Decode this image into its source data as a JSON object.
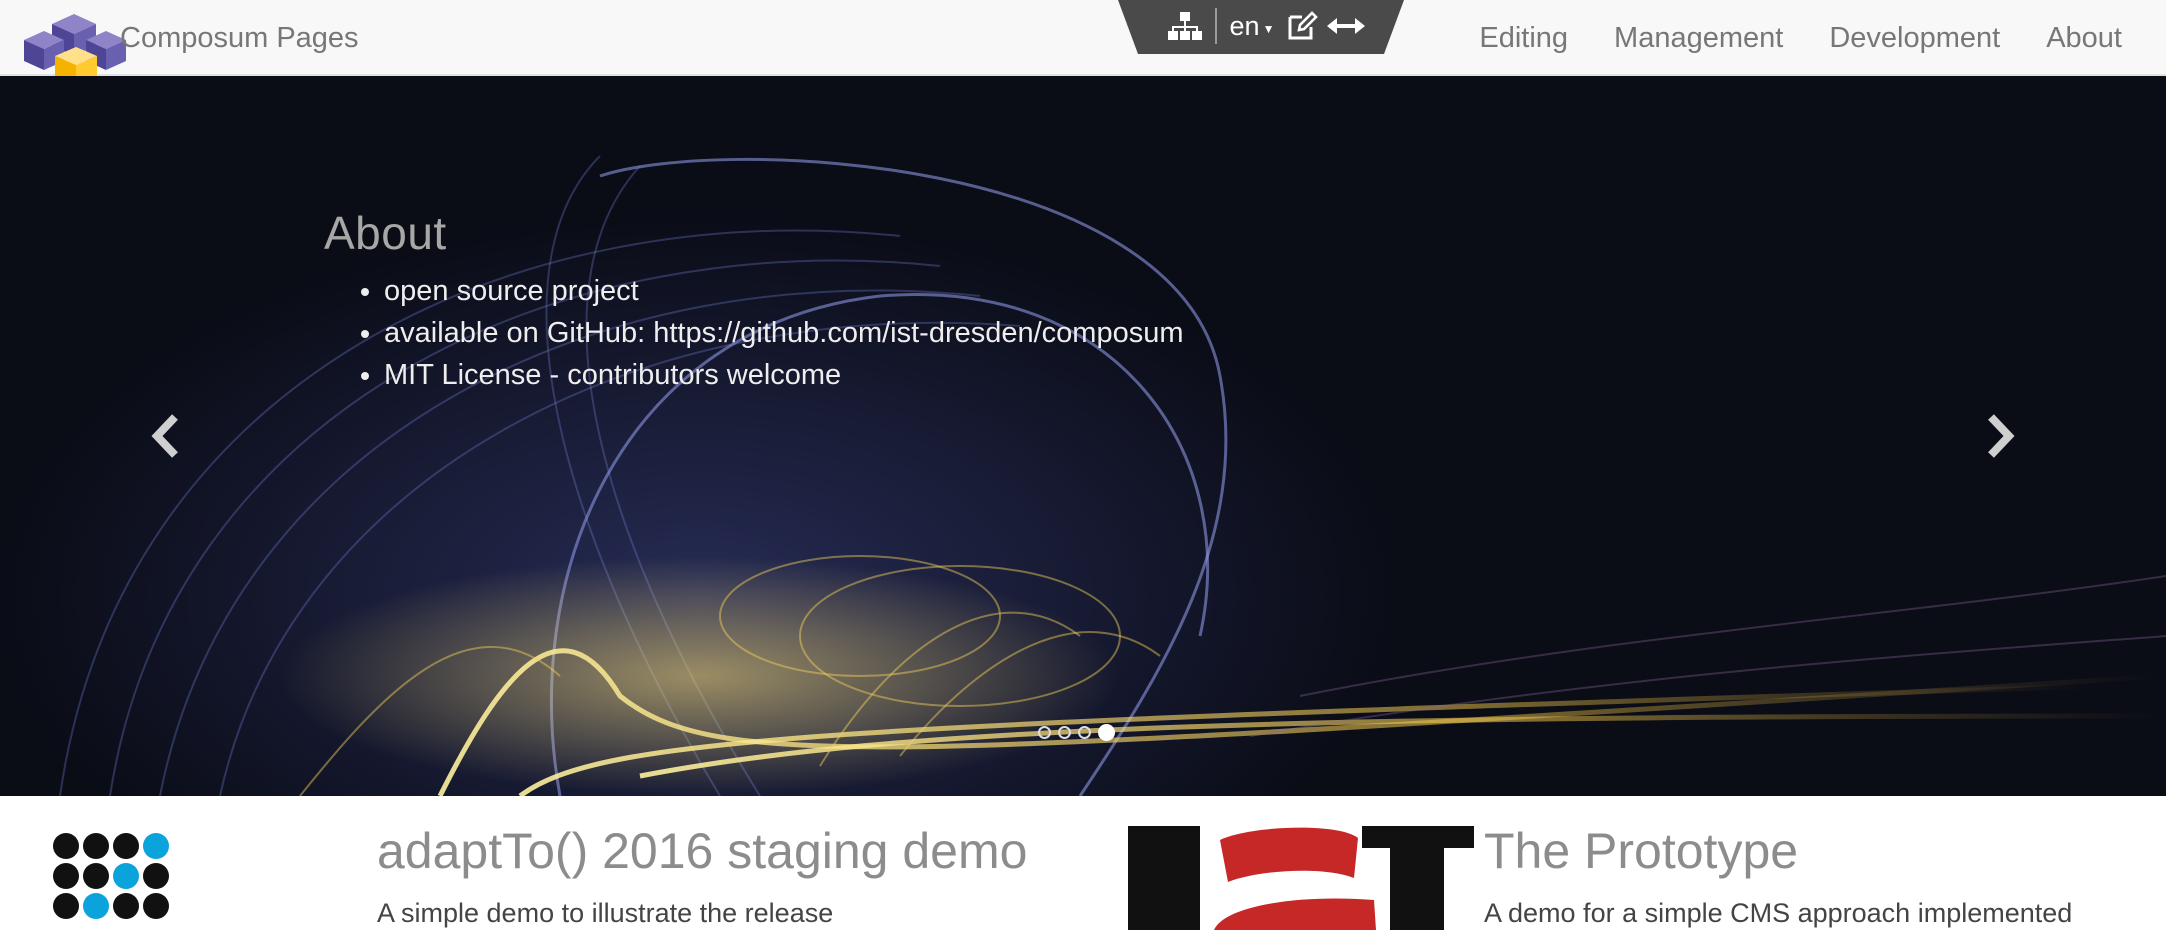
{
  "brand": {
    "name": "Composum Pages",
    "logo_icon": "cubes-logo-icon"
  },
  "toolbar": {
    "tree_icon": "sitemap-icon",
    "language": "en",
    "edit_icon": "edit-icon",
    "resize_icon": "horizontal-arrows-icon"
  },
  "nav": {
    "items": [
      {
        "label": "Editing"
      },
      {
        "label": "Management"
      },
      {
        "label": "Development"
      },
      {
        "label": "About"
      }
    ]
  },
  "carousel": {
    "heading": "About",
    "bullets": [
      "open source project",
      "available on GitHub: https://github.com/ist-dresden/composum",
      "MIT License - contributors welcome"
    ],
    "slide_count": 4,
    "active_slide": 4,
    "prev_icon": "chevron-left-icon",
    "next_icon": "chevron-right-icon"
  },
  "teasers": [
    {
      "title": "adaptTo() 2016 staging demo",
      "text": "A simple demo to illustrate the release",
      "icon": "dot-grid-logo-icon"
    },
    {
      "title": "The Prototype",
      "text": "A  demo for a simple CMS approach implemented",
      "icon": "ist-logo-icon"
    }
  ],
  "colors": {
    "navbar_bg": "#f8f8f8",
    "toolbar_bg": "#4a4a4a",
    "accent_blue": "#0ba3dc",
    "ist_red": "#c62828"
  }
}
